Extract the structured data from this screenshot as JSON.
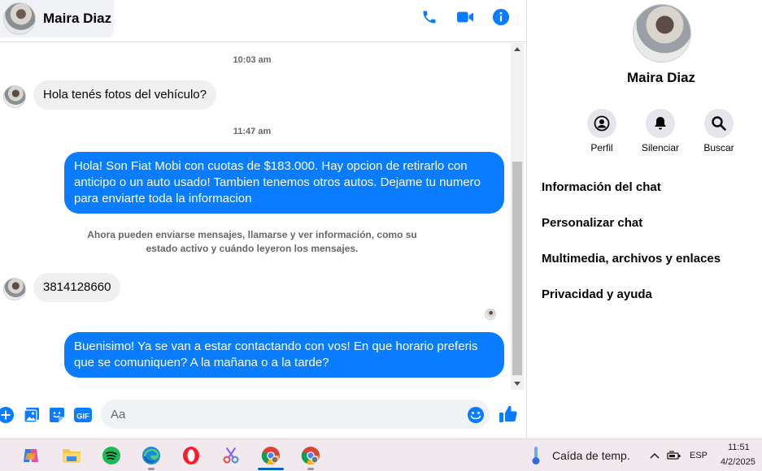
{
  "header": {
    "contact_name": "Maira Diaz",
    "icons": [
      "phone-icon",
      "video-camera-icon",
      "info-icon"
    ]
  },
  "messages": {
    "timestamp_1": "10:03 am",
    "incoming_1": "Hola tenés fotos del vehículo?",
    "timestamp_2": "11:47 am",
    "outgoing_1": "Hola! Son Fiat Mobi con cuotas de $183.000. Hay opcion de retirarlo con anticipo o un auto usado! Tambien tenemos otros autos. Dejame tu numero para enviarte toda la informacion",
    "system_note": "Ahora pueden enviarse mensajes, llamarse y ver información, como su estado activo y cuándo leyeron los mensajes.",
    "incoming_2": "3814128660",
    "outgoing_2": "Buenisimo! Ya se van a estar contactando con vos! En que horario preferis que se comuniquen? A la mañana o a la tarde?"
  },
  "composer": {
    "placeholder": "Aa",
    "gif_label": "GIF"
  },
  "panel": {
    "contact_name": "Maira Diaz",
    "actions": [
      {
        "label": "Perfil",
        "icon": "profile-icon"
      },
      {
        "label": "Silenciar",
        "icon": "bell-icon"
      },
      {
        "label": "Buscar",
        "icon": "search-icon"
      }
    ],
    "menu": [
      "Información del chat",
      "Personalizar chat",
      "Multimedia, archivos y enlaces",
      "Privacidad y ayuda"
    ]
  },
  "taskbar": {
    "weather": "Caída de temp.",
    "language": "ESP",
    "time": "11:51",
    "date": "4/2/2025"
  },
  "colors": {
    "accent": "#0a7cff",
    "incoming_bubble": "#f0f0f0",
    "muted_text": "#65676b"
  }
}
